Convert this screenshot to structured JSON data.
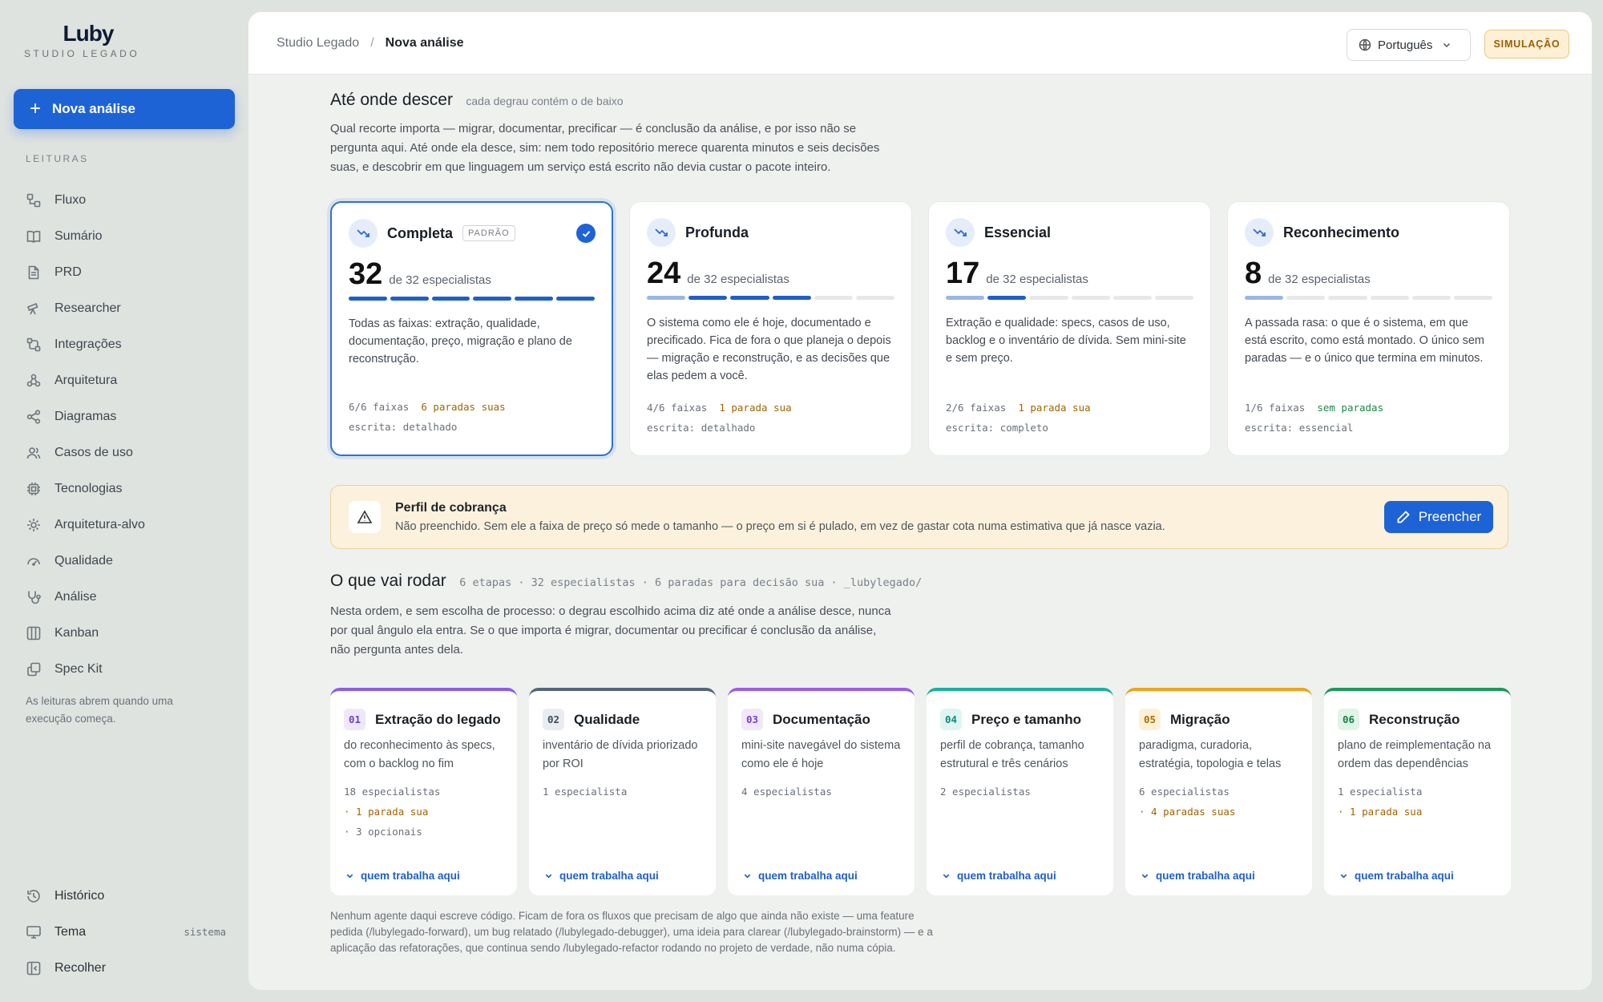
{
  "brand": {
    "logo": "Luby",
    "subtitle": "STUDIO LEGADO"
  },
  "sidebar": {
    "new_button": "Nova análise",
    "section_label": "LEITURAS",
    "items": [
      {
        "label": "Fluxo",
        "icon": "flow-icon"
      },
      {
        "label": "Sumário",
        "icon": "book-icon"
      },
      {
        "label": "PRD",
        "icon": "document-icon"
      },
      {
        "label": "Researcher",
        "icon": "telescope-icon"
      },
      {
        "label": "Integrações",
        "icon": "integrations-icon"
      },
      {
        "label": "Arquitetura",
        "icon": "architecture-icon"
      },
      {
        "label": "Diagramas",
        "icon": "share-icon"
      },
      {
        "label": "Casos de uso",
        "icon": "users-icon"
      },
      {
        "label": "Tecnologias",
        "icon": "chip-icon"
      },
      {
        "label": "Arquitetura-alvo",
        "icon": "target-architecture-icon"
      },
      {
        "label": "Qualidade",
        "icon": "gauge-icon"
      },
      {
        "label": "Análise",
        "icon": "stethoscope-icon"
      },
      {
        "label": "Kanban",
        "icon": "kanban-icon"
      },
      {
        "label": "Spec Kit",
        "icon": "copy-icon"
      }
    ],
    "note": "As leituras abrem quando uma execução começa.",
    "bottom": {
      "history": "Histórico",
      "theme": "Tema",
      "theme_value": "sistema",
      "collapse": "Recolher"
    }
  },
  "header": {
    "crumb_root": "Studio Legado",
    "crumb_current": "Nova análise",
    "language": "Português",
    "mode_badge": "SIMULAÇÃO"
  },
  "depth": {
    "title": "Até onde descer",
    "hint": "cada degrau contém o de baixo",
    "paragraph": "Qual recorte importa — migrar, documentar, precificar — é conclusão da análise, e por isso não se pergunta aqui. Até onde ela desce, sim: nem todo repositório merece quarenta minutos e seis decisões suas, e descobrir em que linguagem um serviço está escrito não devia custar o pacote inteiro.",
    "cards": [
      {
        "name": "Completa",
        "badge": "PADRÃO",
        "selected": true,
        "count": "32",
        "of": "de 32 especialistas",
        "filled": 6,
        "desc": "Todas as faixas: extração, qualidade, documentação, preço, migração e plano de reconstrução.",
        "faixas": "6/6 faixas",
        "paradas": "6 paradas suas",
        "escrita": "escrita: detalhado"
      },
      {
        "name": "Profunda",
        "count": "24",
        "of": "de 32 especialistas",
        "filled": 4,
        "desc": "O sistema como ele é hoje, documentado e precificado. Fica de fora o que planeja o depois — migração e reconstrução, e as decisões que elas pedem a você.",
        "faixas": "4/6 faixas",
        "paradas": "1 parada sua",
        "escrita": "escrita: detalhado"
      },
      {
        "name": "Essencial",
        "count": "17",
        "of": "de 32 especialistas",
        "filled": 2,
        "desc": "Extração e qualidade: specs, casos de uso, backlog e o inventário de dívida. Sem mini-site e sem preço.",
        "faixas": "2/6 faixas",
        "paradas": "1 parada sua",
        "escrita": "escrita: completo"
      },
      {
        "name": "Reconhecimento",
        "count": "8",
        "of": "de 32 especialistas",
        "filled": 1,
        "desc": "A passada rasa: o que é o sistema, em que está escrito, como está montado. O único sem paradas — e o único que termina em minutos.",
        "faixas": "1/6 faixas",
        "paradas": "sem paradas",
        "escrita": "escrita: essencial"
      }
    ]
  },
  "perfil": {
    "title": "Perfil de cobrança",
    "desc": "Não preenchido. Sem ele a faixa de preço só mede o tamanho — o preço em si é pulado, em vez de gastar cota numa estimativa que já nasce vazia.",
    "button": "Preencher"
  },
  "run": {
    "title": "O que vai rodar",
    "meta": "6 etapas · 32 especialistas · 6 paradas para decisão sua · _lubylegado/",
    "paragraph": "Nesta ordem, e sem escolha de processo: o degrau escolhido acima diz até onde a análise desce, nunca por qual ângulo ela entra. Se o que importa é migrar, documentar ou precificar é conclusão da análise, não pergunta antes dela.",
    "steps": [
      {
        "num": "01",
        "name": "Extração do legado",
        "desc": "do reconhecimento às specs, com o backlog no fim",
        "meta": [
          "18 especialistas",
          "· 1 parada sua",
          "· 3 opcionais"
        ],
        "link": "quem trabalha aqui",
        "color": "#8a5cf0",
        "numbg": "#efe8fd",
        "numfg": "#6a3fd6"
      },
      {
        "num": "02",
        "name": "Qualidade",
        "desc": "inventário de dívida priorizado por ROI",
        "meta": [
          "1 especialista"
        ],
        "link": "quem trabalha aqui",
        "color": "#55657a",
        "numbg": "#e9ecf0",
        "numfg": "#3f4c5c"
      },
      {
        "num": "03",
        "name": "Documentação",
        "desc": "mini-site navegável do sistema como ele é hoje",
        "meta": [
          "4 especialistas"
        ],
        "link": "quem trabalha aqui",
        "color": "#9a5cf0",
        "numbg": "#f1e8fd",
        "numfg": "#7a3fd6"
      },
      {
        "num": "04",
        "name": "Preço e tamanho",
        "desc": "perfil de cobrança, tamanho estrutural e três cenários",
        "meta": [
          "2 especialistas"
        ],
        "link": "quem trabalha aqui",
        "color": "#1bb0a0",
        "numbg": "#dff5f2",
        "numfg": "#0f8a7d"
      },
      {
        "num": "05",
        "name": "Migração",
        "desc": "paradigma, curadoria, estratégia, topologia e telas",
        "meta": [
          "6 especialistas",
          "· 4 paradas suas"
        ],
        "link": "quem trabalha aqui",
        "color": "#f0a21c",
        "numbg": "#fdf0d8",
        "numfg": "#b06e00"
      },
      {
        "num": "06",
        "name": "Reconstrução",
        "desc": "plano de reimplementação na ordem das dependências",
        "meta": [
          "1 especialista",
          "· 1 parada sua"
        ],
        "link": "quem trabalha aqui",
        "color": "#1b9a5a",
        "numbg": "#e0f4e8",
        "numfg": "#17804a"
      }
    ]
  },
  "footnote": "Nenhum agente daqui escreve código. Ficam de fora os fluxos que precisam de algo que ainda não existe — uma feature pedida (/lubylegado-forward), um bug relatado (/lubylegado-debugger), uma ideia para clarear (/lubylegado-brainstorm) — e a aplicação das refatorações, que continua sendo /lubylegado-refactor rodando no projeto de verdade, não numa cópia."
}
